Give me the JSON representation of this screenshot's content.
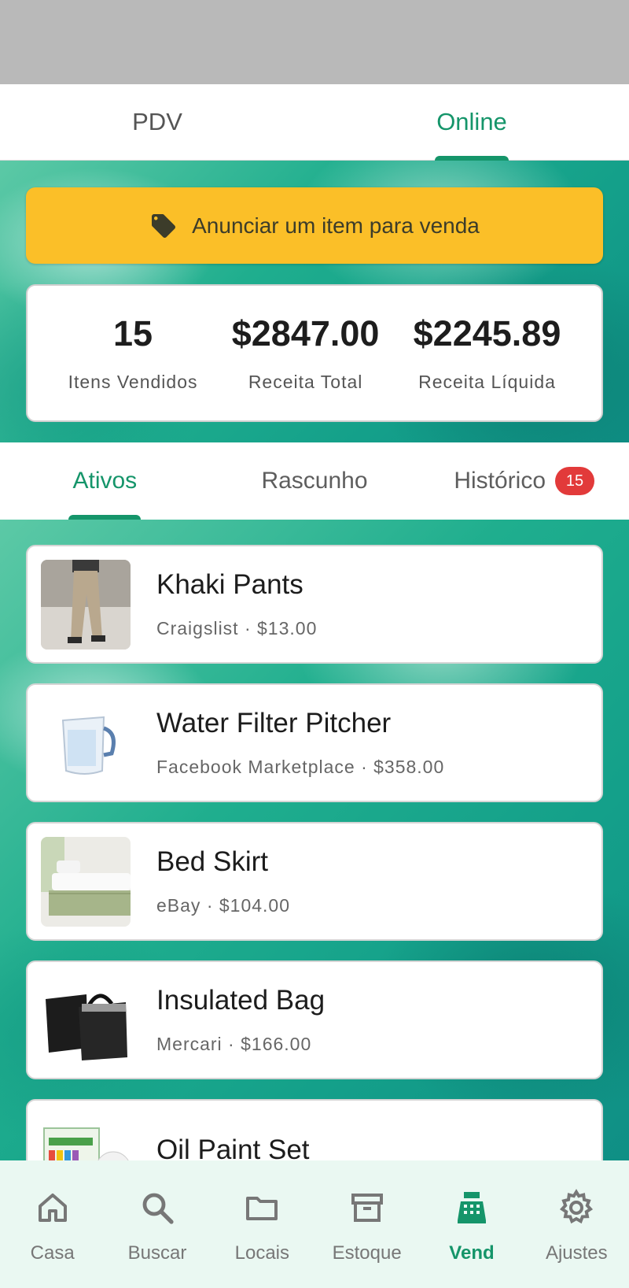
{
  "top_tabs": [
    {
      "label": "PDV"
    },
    {
      "label": "Online"
    }
  ],
  "sell_button": {
    "label": "Anunciar um item para venda",
    "icon": "tag-icon",
    "color": "#fbbf28"
  },
  "stats": [
    {
      "value": "15",
      "label": "Itens Vendidos"
    },
    {
      "value": "$2847.00",
      "label": "Receita Total"
    },
    {
      "value": "$2245.89",
      "label": "Receita Líquida"
    }
  ],
  "sub_tabs": [
    {
      "label": "Ativos"
    },
    {
      "label": "Rascunho"
    },
    {
      "label": "Histórico",
      "badge": "15"
    }
  ],
  "listings": [
    {
      "title": "Khaki Pants",
      "subtitle": "Craigslist · $13.00"
    },
    {
      "title": "Water Filter Pitcher",
      "subtitle": "Facebook Marketplace · $358.00"
    },
    {
      "title": "Bed Skirt",
      "subtitle": "eBay · $104.00"
    },
    {
      "title": "Insulated Bag",
      "subtitle": "Mercari · $166.00"
    },
    {
      "title": "Oil Paint Set",
      "subtitle": ""
    }
  ],
  "bottom_nav": [
    {
      "label": "Casa",
      "icon": "home-icon"
    },
    {
      "label": "Buscar",
      "icon": "search-icon"
    },
    {
      "label": "Locais",
      "icon": "folder-icon"
    },
    {
      "label": "Estoque",
      "icon": "archive-icon"
    },
    {
      "label": "Vend",
      "icon": "cash-register-icon"
    },
    {
      "label": "Ajustes",
      "icon": "gear-icon"
    }
  ],
  "colors": {
    "accent": "#15956a",
    "badge": "#e23a3a"
  }
}
